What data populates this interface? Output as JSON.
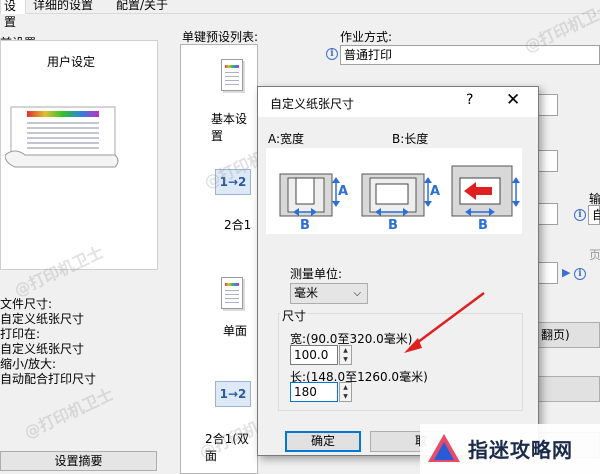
{
  "tabs": [
    "设置",
    "详细的设置",
    "配置/关于"
  ],
  "left": {
    "current_settings": "前设置",
    "user_setting": "用户设定",
    "paper_size_label": "文件尺寸:",
    "paper_size_value": "自定义纸张尺寸",
    "print_on_label": "打印在:",
    "print_on_value": "自定义纸张尺寸",
    "scale_label": "缩小/放大:",
    "scale_value": "自动配合打印尺寸",
    "summary_button": "设置摘要"
  },
  "presets": {
    "label": "单键预设列表:",
    "items": [
      "基本设置",
      "2合1",
      "单面",
      "2合1(双面"
    ],
    "nup_icon_text": "1→2"
  },
  "right": {
    "job_type_label": "作业方式:",
    "job_type_value": "普通打印",
    "partial_label_1": "输",
    "partial_value_1": "自",
    "partial_label_2": "页",
    "partial_button": "翻页)"
  },
  "dialog": {
    "title": "自定义纸张尺寸",
    "help": "?",
    "close": "✕",
    "label_a": "A:宽度",
    "label_b": "B:长度",
    "mark_a": "A",
    "mark_b": "B",
    "unit_label": "测量单位:",
    "unit_value": "毫米",
    "size_group": "尺寸",
    "width_label": "宽:(90.0至320.0毫米)",
    "width_value": "100.0",
    "length_label": "长:(148.0至1260.0毫米)",
    "length_value": "180",
    "ok_button": "确定",
    "cancel_button": "取"
  },
  "watermark": "@打印机卫士",
  "brand": "指迷攻略网",
  "colors": {
    "arrow": "#e02020",
    "accent": "#0078d7",
    "blue_mark": "#2c6fd6"
  }
}
